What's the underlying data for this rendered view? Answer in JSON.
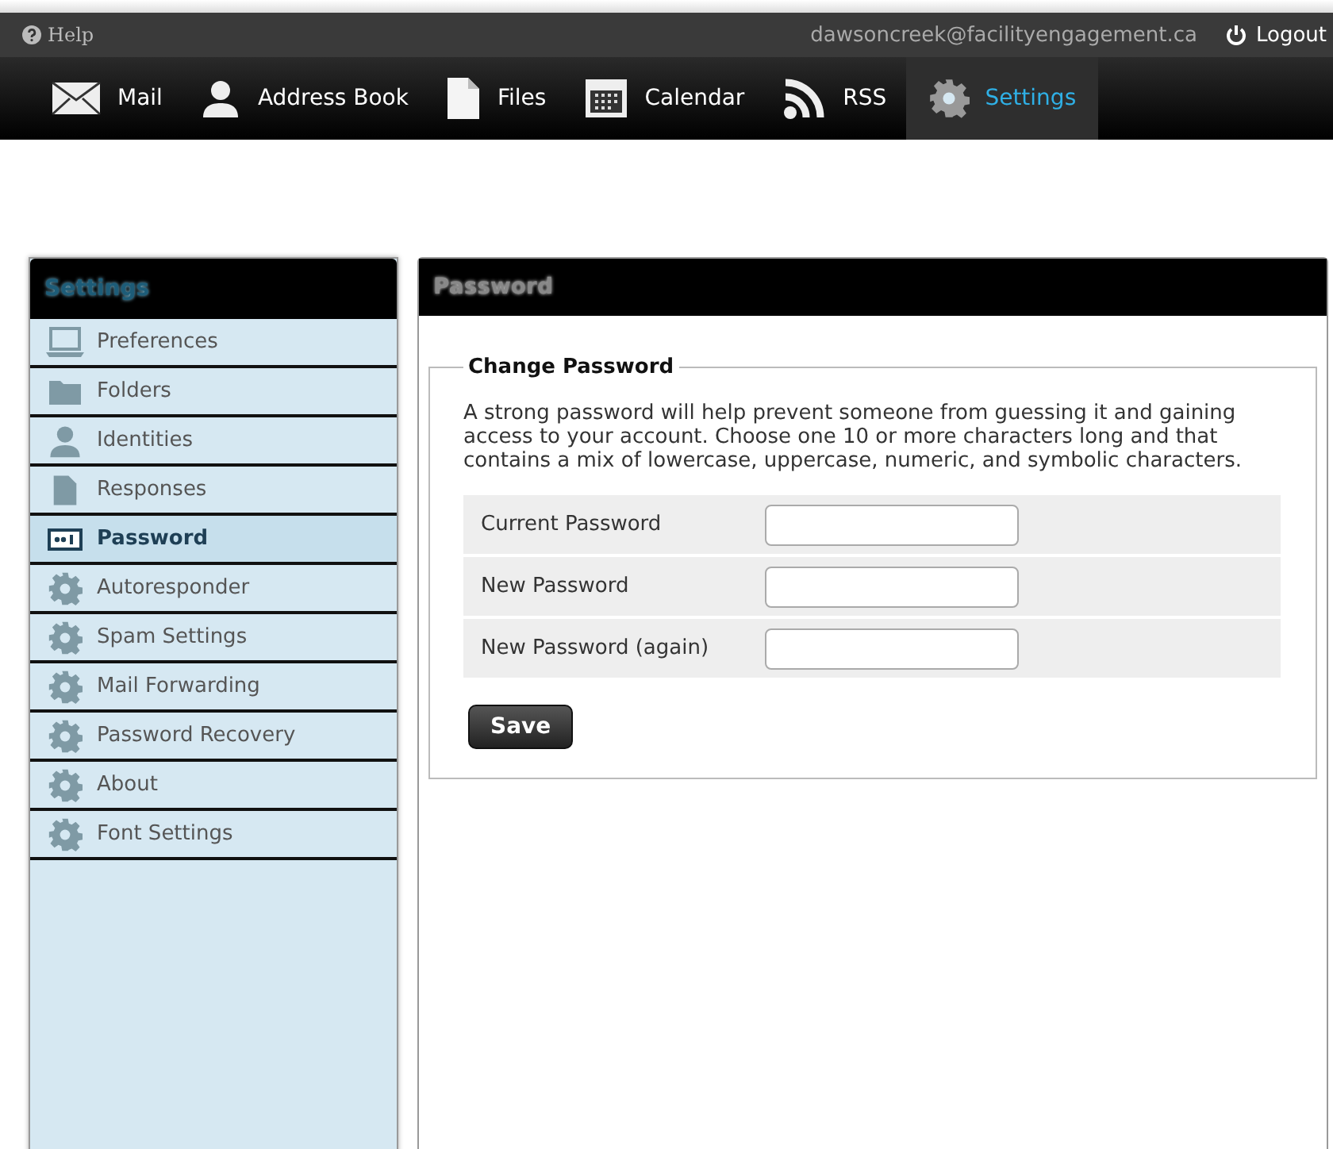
{
  "top_bar": {
    "help": "Help",
    "account": "dawsoncreek@facilityengagement.ca",
    "logout": "Logout"
  },
  "nav": [
    {
      "label": "Mail",
      "selected": false
    },
    {
      "label": "Address Book",
      "selected": false
    },
    {
      "label": "Files",
      "selected": false
    },
    {
      "label": "Calendar",
      "selected": false
    },
    {
      "label": "RSS",
      "selected": false
    },
    {
      "label": "Settings",
      "selected": true
    }
  ],
  "sidebar": {
    "title": "Settings",
    "items": [
      {
        "label": "Preferences",
        "selected": false
      },
      {
        "label": "Folders",
        "selected": false
      },
      {
        "label": "Identities",
        "selected": false
      },
      {
        "label": "Responses",
        "selected": false
      },
      {
        "label": "Password",
        "selected": true
      },
      {
        "label": "Autoresponder",
        "selected": false
      },
      {
        "label": "Spam Settings",
        "selected": false
      },
      {
        "label": "Mail Forwarding",
        "selected": false
      },
      {
        "label": "Password Recovery",
        "selected": false
      },
      {
        "label": "About",
        "selected": false
      },
      {
        "label": "Font Settings",
        "selected": false
      }
    ]
  },
  "panel": {
    "title": "Password",
    "section": "Change Password",
    "description": "A strong password will help prevent someone from guessing it and gaining access to your account. Choose one 10 or more characters long and that contains a mix of lowercase, uppercase, numeric, and symbolic characters.",
    "fields": [
      {
        "label": "Current Password"
      },
      {
        "label": "New Password"
      },
      {
        "label": "New Password (again)"
      }
    ],
    "save": "Save"
  }
}
